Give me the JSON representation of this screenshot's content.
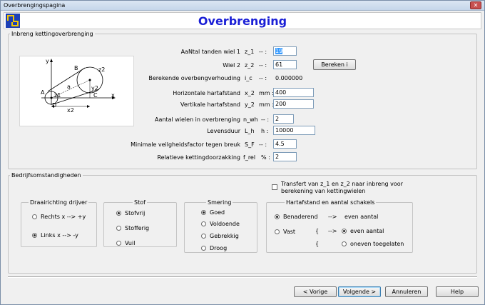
{
  "window": {
    "title": "Overbrengingspagina"
  },
  "header": {
    "heading": "Overbrenging"
  },
  "inbreng": {
    "legend": "Inbreng kettingoverbrenging",
    "rows": [
      {
        "label": "AaNtal tanden wiel 1",
        "symbol": "z_1",
        "unit": "--  :",
        "value": "19"
      },
      {
        "label": "Wiel 2",
        "symbol": "z_2",
        "unit": "--  :",
        "value": "61"
      },
      {
        "label": "Berekende overbengverhouding",
        "symbol": "i_c",
        "unit": "--  :",
        "value": "0.000000"
      },
      {
        "label": "Horizontale hartafstand",
        "symbol": "x_2",
        "unit": "mm  :",
        "value": "400"
      },
      {
        "label": "Vertikale hartafstand",
        "symbol": "y_2",
        "unit": "mm  :",
        "value": "200"
      },
      {
        "label": "Aantal wielen in overbrenging",
        "symbol": "n_wh",
        "unit": "--  :",
        "value": "2"
      },
      {
        "label": "Levensduur",
        "symbol": "L_h",
        "unit": "h  :",
        "value": "10000"
      },
      {
        "label": "Minimale veilgheidsfactor tegen breuk",
        "symbol": "S_F",
        "unit": "--  :",
        "value": "4.5"
      },
      {
        "label": "Relatieve kettingdoorzakking",
        "symbol": "f_rel",
        "unit": "%  :",
        "value": "2"
      }
    ],
    "bereken_label": "Bereken i",
    "diagram_labels": {
      "y": "y",
      "x": "x",
      "a": "A",
      "b": "B",
      "c": "C",
      "d": "D",
      "z1": "z1",
      "z2": "z2",
      "a_len": "a",
      "x2": "x2",
      "y2": "y2"
    }
  },
  "bedrijf": {
    "legend": "Bedrijfsomstandigheden",
    "transfert_label_1": "Transfert van z_1 en z_2 naar inbreng voor",
    "transfert_label_2": "berekening van kettingwielen",
    "draairichting": {
      "legend": "Draairichting drijver",
      "options": [
        {
          "label": "Rechts  x --> +y",
          "checked": false
        },
        {
          "label": "Links   x --> -y",
          "checked": true
        }
      ]
    },
    "stof": {
      "legend": "Stof",
      "options": [
        {
          "label": "Stofvrij",
          "checked": true
        },
        {
          "label": "Stofferig",
          "checked": false
        },
        {
          "label": "Vuil",
          "checked": false
        }
      ]
    },
    "smering": {
      "legend": "Smering",
      "options": [
        {
          "label": "Goed",
          "checked": true
        },
        {
          "label": "Voldoende",
          "checked": false
        },
        {
          "label": "Gebrekkig",
          "checked": false
        },
        {
          "label": "Droog",
          "checked": false
        }
      ]
    },
    "hartafstand": {
      "legend": "Hartafstand      en     aantal schakels",
      "benaderend": "Benaderend",
      "vast": "Vast",
      "arrow": "-->",
      "brace": "{",
      "even_aantal_1": "even aantal",
      "even_aantal_2": "even aantal",
      "oneven": "oneven toegelaten"
    }
  },
  "footer": {
    "vorige": "< Vorige",
    "volgende": "Volgende >",
    "annuleren": "Annuleren",
    "help": "Help"
  }
}
